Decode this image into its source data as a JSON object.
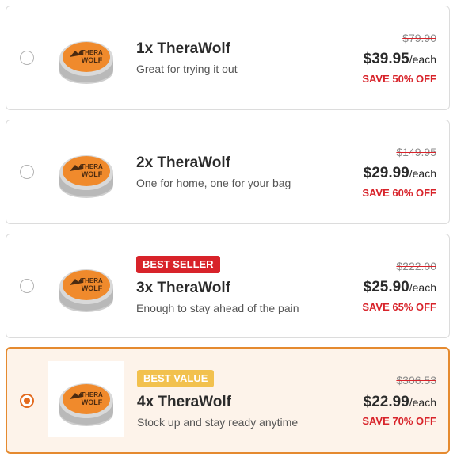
{
  "options": [
    {
      "title": "1x TheraWolf",
      "subtitle": "Great for trying it out",
      "badge": "",
      "original_price": "$79.90",
      "price": "$39.95",
      "unit": "/each",
      "savings": "SAVE 50% OFF",
      "selected": false,
      "tin_label_line1": "THERA",
      "tin_label_line2": "WOLF"
    },
    {
      "title": "2x TheraWolf",
      "subtitle": "One for home, one for your bag",
      "badge": "",
      "original_price": "$149.95",
      "price": "$29.99",
      "unit": "/each",
      "savings": "SAVE 60% OFF",
      "selected": false,
      "tin_label_line1": "THERA",
      "tin_label_line2": "WOLF"
    },
    {
      "title": "3x TheraWolf",
      "subtitle": "Enough to stay ahead of the pain",
      "badge": "BEST SELLER",
      "original_price": "$222.00",
      "price": "$25.90",
      "unit": "/each",
      "savings": "SAVE 65% OFF",
      "selected": false,
      "tin_label_line1": "THERA",
      "tin_label_line2": "WOLF"
    },
    {
      "title": "4x TheraWolf",
      "subtitle": "Stock up and stay ready anytime",
      "badge": "BEST VALUE",
      "original_price": "$306.53",
      "price": "$22.99",
      "unit": "/each",
      "savings": "SAVE 70% OFF",
      "selected": true,
      "tin_label_line1": "THERA",
      "tin_label_line2": "WOLF"
    }
  ],
  "colors": {
    "accent": "#e36a1e",
    "selected_border": "#e58a2f",
    "selected_background": "#fdf3ea",
    "sale_red": "#d8232a",
    "best_value_gold": "#f2c14e"
  },
  "icons": {
    "product": "therawolf-tin-icon",
    "radio": "radio-icon"
  }
}
